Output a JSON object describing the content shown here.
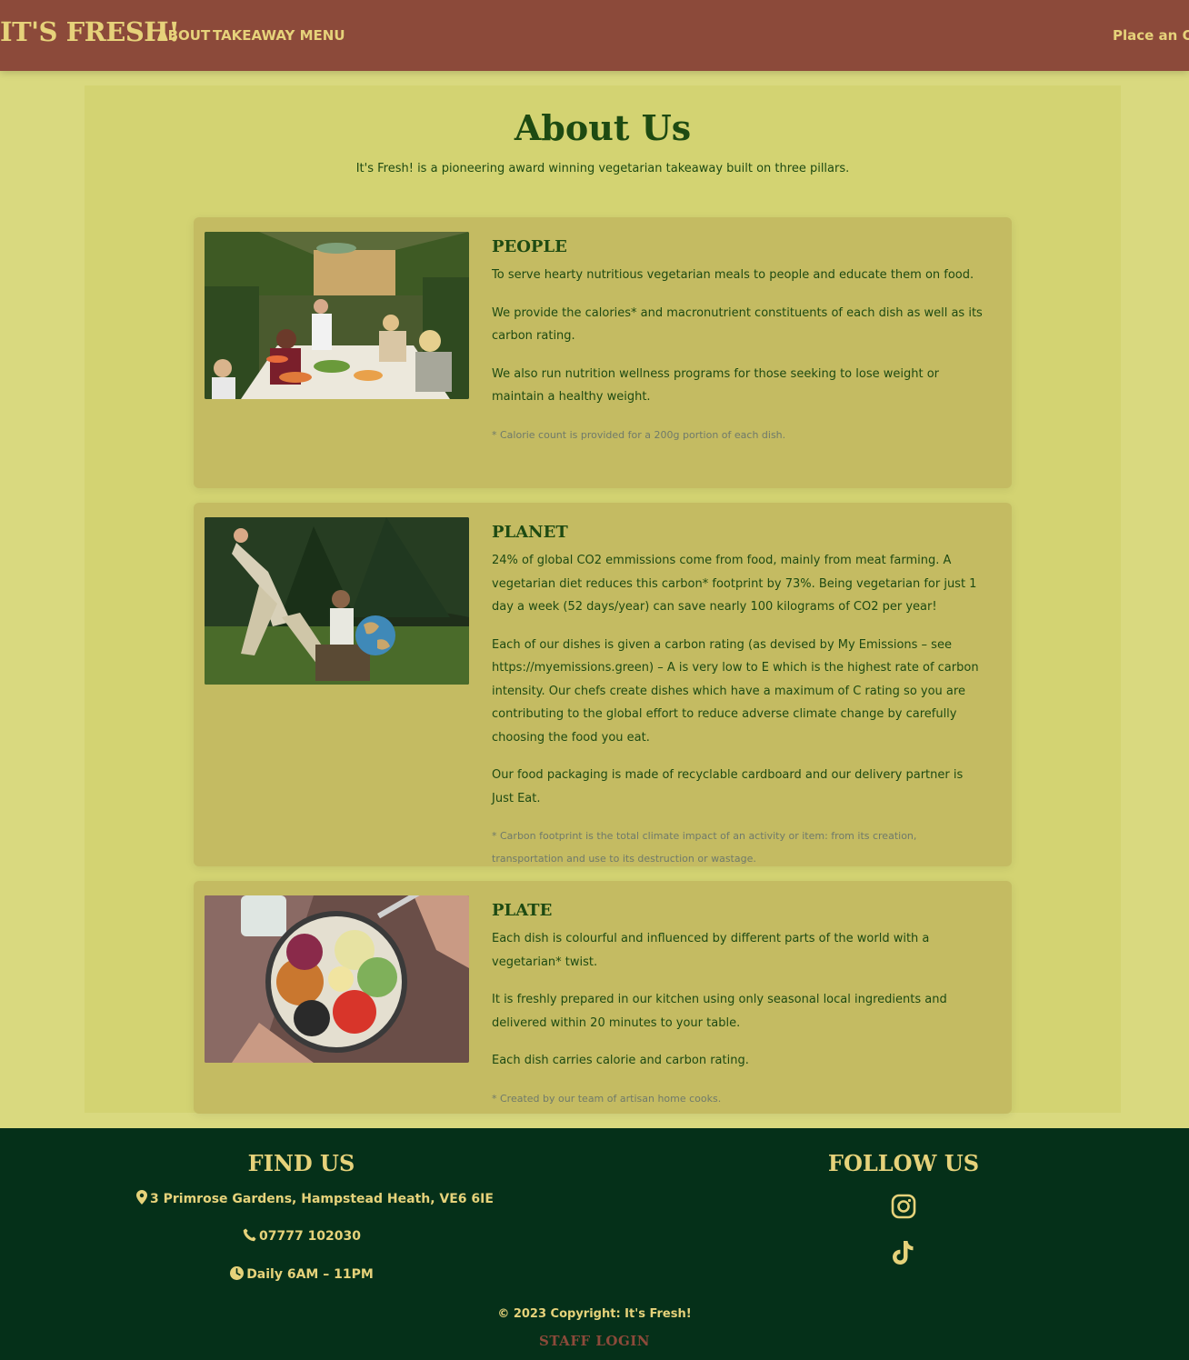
{
  "navbar": {
    "brand": "IT'S FRESH!",
    "links": [
      "ABOUT",
      "TAKEAWAY MENU"
    ],
    "order_label": "Place an Orde"
  },
  "main": {
    "title": "About Us",
    "intro": "It's Fresh! is a pioneering award winning vegetarian takeaway built on three pillars.",
    "cards": [
      {
        "title": "PEOPLE",
        "paragraphs": [
          "To serve hearty nutritious vegetarian meals to people and educate them on food.",
          "We provide the calories* and macronutrient constituents of each dish as well as its carbon rating.",
          "We also run nutrition wellness programs for those seeking to lose weight or maintain a healthy weight."
        ],
        "note": "* Calorie count is provided for a 200g portion of each dish."
      },
      {
        "title": "PLANET",
        "paragraphs": [
          "24% of global CO2 emmissions come from food, mainly from meat farming. A vegetarian diet reduces this carbon* footprint by 73%. Being vegetarian for just 1 day a week (52 days/year) can save nearly 100 kilograms of CO2 per year!",
          "Each of our dishes is given a carbon rating (as devised by My Emissions – see https://myemissions.green) – A is very low to E which is the highest rate of carbon intensity. Our chefs create dishes which have a maximum of C rating so you are contributing to the global effort to reduce adverse climate change by carefully choosing the food you eat.",
          "Our food packaging is made of recyclable cardboard and our delivery partner is Just Eat."
        ],
        "note": "* Carbon footprint is the total climate impact of an activity or item: from its creation, transportation and use to its destruction or wastage."
      },
      {
        "title": "PLATE",
        "paragraphs": [
          "Each dish is colourful and influenced by different parts of the world with a vegetarian* twist.",
          "It is freshly prepared in our kitchen using only seasonal local ingredients and delivered within 20 minutes to your table.",
          "Each dish carries calorie and carbon rating."
        ],
        "note": "* Created by our team of artisan home cooks."
      }
    ]
  },
  "footer": {
    "find_title": "FIND US",
    "address": "3 Primrose Gardens, Hampstead Heath, VE6 6IE",
    "phone": "07777 102030",
    "hours": "Daily 6AM – 11PM",
    "follow_title": "FOLLOW US",
    "social_icons": [
      "instagram-icon",
      "tiktok-icon"
    ],
    "copyright": "© 2023 Copyright: It's Fresh!",
    "staff_login": "STAFF LOGIN"
  },
  "colors": {
    "navbar": "#8c4a3a",
    "accent": "#e6d27a",
    "page_bg": "#d9d97f",
    "card_bg": "#c4bb62",
    "text_green": "#1e4a12",
    "footer_bg": "#053019"
  }
}
